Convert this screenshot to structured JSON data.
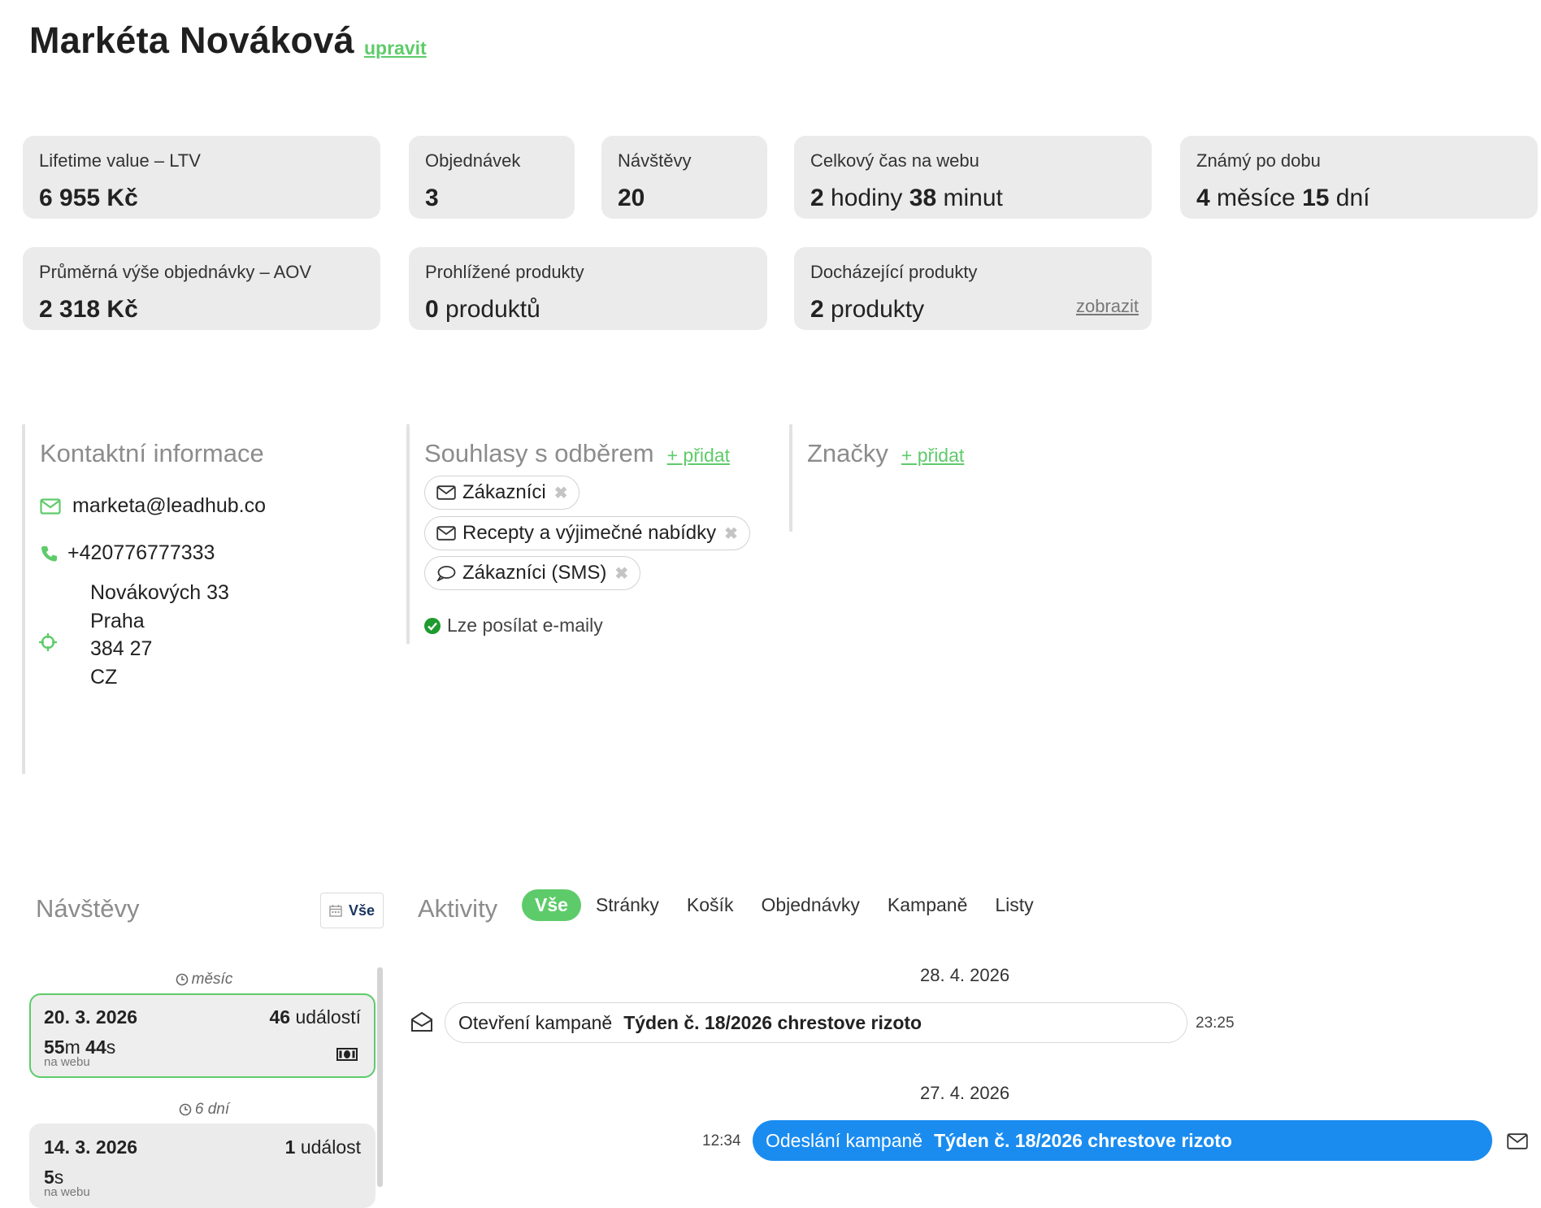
{
  "header": {
    "name": "Markéta Nováková",
    "edit_label": "upravit"
  },
  "stats": {
    "ltv": {
      "label": "Lifetime value – LTV",
      "value": "6 955 Kč"
    },
    "orders": {
      "label": "Objednávek",
      "value": "3"
    },
    "visits": {
      "label": "Návštěvy",
      "value": "20"
    },
    "time_on_web": {
      "label": "Celkový čas na webu",
      "v1": "2",
      "u1": "hodiny",
      "v2": "38",
      "u2": "minut"
    },
    "known_for": {
      "label": "Známý po dobu",
      "v1": "4",
      "u1": "měsíce",
      "v2": "15",
      "u2": "dní"
    },
    "aov": {
      "label": "Průměrná výše objednávky – AOV",
      "value": "2 318 Kč"
    },
    "viewed": {
      "label": "Prohlížené produkty",
      "v": "0",
      "u": "produktů"
    },
    "running_out": {
      "label": "Docházející produkty",
      "v": "2",
      "u": "produkty",
      "link": "zobrazit"
    }
  },
  "contact": {
    "title": "Kontaktní informace",
    "email": "marketa@leadhub.co",
    "phone": "+420776777333",
    "address": [
      "Novákových 33",
      "Praha",
      "384 27",
      "CZ"
    ]
  },
  "consents": {
    "title": "Souhlasy s odběrem",
    "add_label": "+ přidat",
    "items": [
      {
        "label": "Zákazníci",
        "icon": "envelope-icon"
      },
      {
        "label": "Recepty a výjimečné nabídky",
        "icon": "envelope-icon"
      },
      {
        "label": "Zákazníci (SMS)",
        "icon": "speech-bubble-icon"
      }
    ],
    "remove_glyph": "✖",
    "status": "Lze posílat e-maily"
  },
  "tags": {
    "title": "Značky",
    "add_label": "+ přidat"
  },
  "visits": {
    "title": "Návštěvy",
    "all_label": "Vše",
    "list": [
      {
        "ago": "měsíc",
        "date": "20. 3. 2026",
        "events_n": "46",
        "events_u": "událostí",
        "dur_m": "55",
        "dur_s": "44",
        "sub": "na webu"
      },
      {
        "ago": "6 dní",
        "date": "14. 3. 2026",
        "events_n": "1",
        "events_u": "událost",
        "dur_s": "5",
        "sub": "na webu"
      }
    ],
    "unit_m": "m",
    "unit_s": "s"
  },
  "activities": {
    "title": "Aktivity",
    "tabs": [
      "Vše",
      "Stránky",
      "Košík",
      "Objednávky",
      "Kampaně",
      "Listy"
    ],
    "groups": [
      {
        "date": "28. 4. 2026",
        "label": "Otevření kampaně",
        "name": "Týden č. 18/2026 chrestove rizoto",
        "time": "23:25"
      },
      {
        "date": "27. 4. 2026",
        "label": "Odeslání kampaně",
        "name": "Týden č. 18/2026 chrestove rizoto",
        "time": "12:34"
      }
    ]
  },
  "colors": {
    "accent": "#5ecb6a",
    "blue": "#1a8cf0",
    "card": "#ebebeb"
  }
}
